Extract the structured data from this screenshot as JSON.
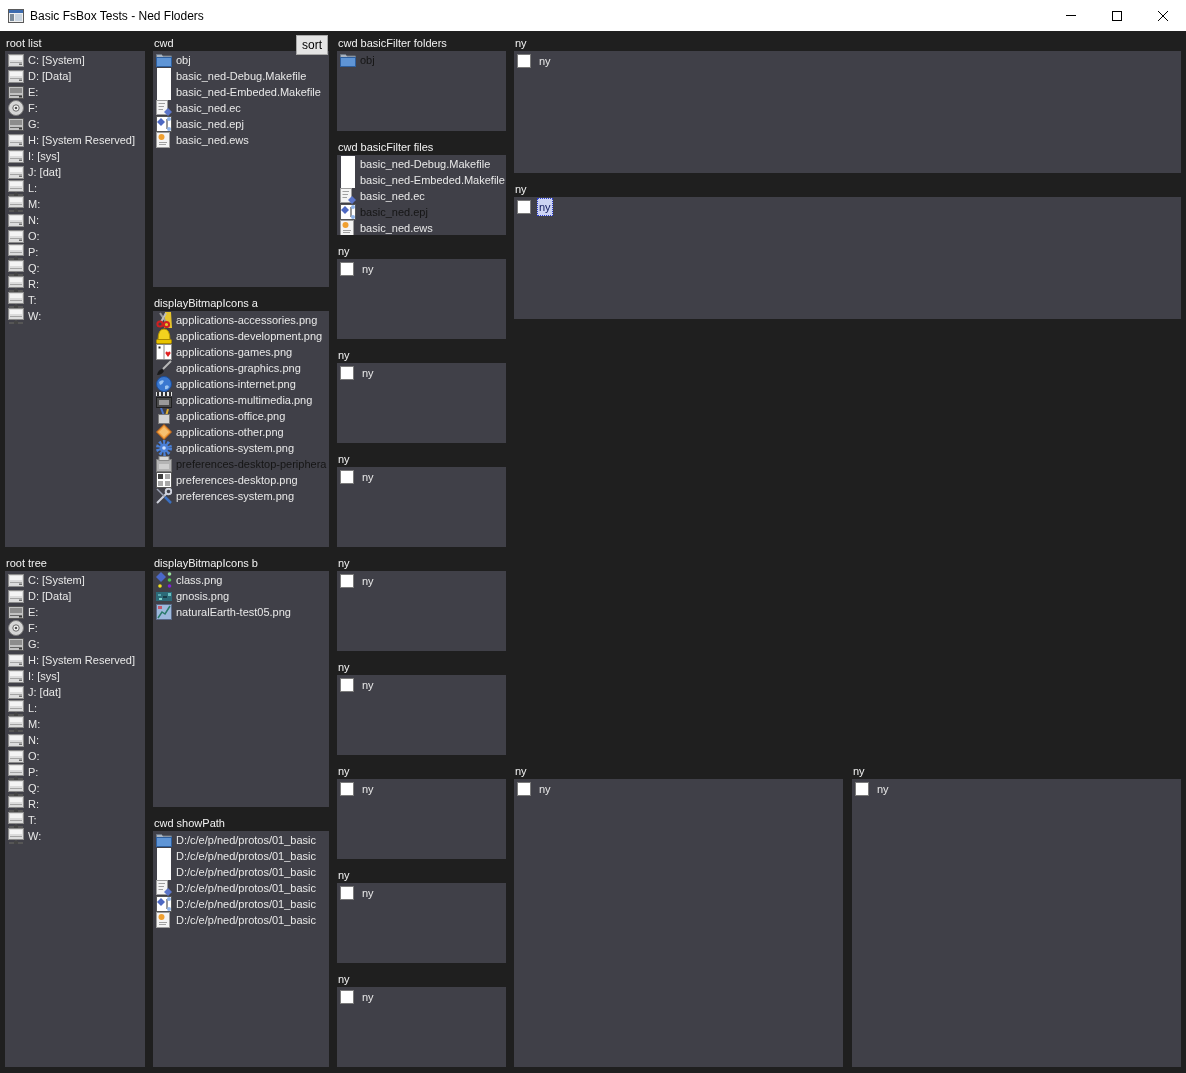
{
  "window": {
    "title": "Basic FsBox Tests - Ned Floders"
  },
  "columns": [
    {
      "sections": [
        {
          "kind": "list",
          "label": "root list",
          "items": [
            {
              "text": "C: [System]",
              "kind": "hdd",
              "selected": false
            },
            {
              "text": "D: [Data]",
              "kind": "hdd",
              "selected": false
            },
            {
              "text": "E:",
              "kind": "disk",
              "selected": false
            },
            {
              "text": "F:",
              "kind": "cd",
              "selected": false
            },
            {
              "text": "G:",
              "kind": "disk",
              "selected": false
            },
            {
              "text": "H: [System Reserved]",
              "kind": "hdd",
              "selected": false
            },
            {
              "text": "I: [sys]",
              "kind": "hdd",
              "selected": false
            },
            {
              "text": "J: [dat]",
              "kind": "hdd",
              "selected": false
            },
            {
              "text": "L:",
              "kind": "net",
              "selected": false
            },
            {
              "text": "M:",
              "kind": "net",
              "selected": false
            },
            {
              "text": "N:",
              "kind": "hdd",
              "selected": false
            },
            {
              "text": "O:",
              "kind": "hdd",
              "selected": false
            },
            {
              "text": "P:",
              "kind": "net",
              "selected": false
            },
            {
              "text": "Q:",
              "kind": "net",
              "selected": false
            },
            {
              "text": "R:",
              "kind": "net",
              "selected": false
            },
            {
              "text": "T:",
              "kind": "net",
              "selected": false
            },
            {
              "text": "W:",
              "kind": "net",
              "selected": false
            }
          ]
        },
        {
          "kind": "list",
          "label": "root tree",
          "items": [
            {
              "text": "C: [System]",
              "kind": "hdd",
              "selected": false
            },
            {
              "text": "D: [Data]",
              "kind": "hdd",
              "selected": false
            },
            {
              "text": "E:",
              "kind": "disk",
              "selected": false
            },
            {
              "text": "F:",
              "kind": "cd",
              "selected": false
            },
            {
              "text": "G:",
              "kind": "disk",
              "selected": false
            },
            {
              "text": "H: [System Reserved]",
              "kind": "hdd",
              "selected": false
            },
            {
              "text": "I: [sys]",
              "kind": "hdd",
              "selected": false
            },
            {
              "text": "J: [dat]",
              "kind": "hdd",
              "selected": false
            },
            {
              "text": "L:",
              "kind": "net",
              "selected": false
            },
            {
              "text": "M:",
              "kind": "net",
              "selected": false
            },
            {
              "text": "N:",
              "kind": "hdd",
              "selected": false
            },
            {
              "text": "O:",
              "kind": "hdd",
              "selected": false
            },
            {
              "text": "P:",
              "kind": "net",
              "selected": false
            },
            {
              "text": "Q:",
              "kind": "net",
              "selected": false
            },
            {
              "text": "R:",
              "kind": "net",
              "selected": false
            },
            {
              "text": "T:",
              "kind": "net",
              "selected": false
            },
            {
              "text": "W:",
              "kind": "net",
              "selected": false
            }
          ]
        }
      ]
    },
    {
      "sections": [
        {
          "kind": "list",
          "label": "cwd",
          "button": "sort",
          "items": [
            {
              "text": "obj",
              "kind": "folder",
              "selected": false
            },
            {
              "text": "basic_ned-Debug.Makefile",
              "kind": "blank",
              "selected": false
            },
            {
              "text": "basic_ned-Embeded.Makefile",
              "kind": "blank",
              "selected": false
            },
            {
              "text": "basic_ned.ec",
              "kind": "source",
              "selected": false
            },
            {
              "text": "basic_ned.epj",
              "kind": "project",
              "selected": false
            },
            {
              "text": "basic_ned.ews",
              "kind": "workspace",
              "selected": false
            }
          ]
        },
        {
          "kind": "list",
          "label": "displayBitmapIcons a",
          "items": [
            {
              "text": "applications-accessories.png",
              "kind": "scissors",
              "selected": false
            },
            {
              "text": "applications-development.png",
              "kind": "hardhat",
              "selected": false
            },
            {
              "text": "applications-games.png",
              "kind": "cards",
              "selected": false
            },
            {
              "text": "applications-graphics.png",
              "kind": "brush",
              "selected": false
            },
            {
              "text": "applications-internet.png",
              "kind": "globe",
              "selected": false
            },
            {
              "text": "applications-multimedia.png",
              "kind": "clapper",
              "selected": false
            },
            {
              "text": "applications-office.png",
              "kind": "cup",
              "selected": false
            },
            {
              "text": "applications-other.png",
              "kind": "diamond",
              "selected": false
            },
            {
              "text": "applications-system.png",
              "kind": "gear",
              "selected": false
            },
            {
              "text": "preferences-desktop-periphera",
              "kind": "device",
              "selected": true
            },
            {
              "text": "preferences-desktop.png",
              "kind": "desktop",
              "selected": false
            },
            {
              "text": "preferences-system.png",
              "kind": "tools",
              "selected": false
            }
          ]
        },
        {
          "kind": "list",
          "label": "displayBitmapIcons b",
          "items": [
            {
              "text": "class.png",
              "kind": "class",
              "selected": false
            },
            {
              "text": "gnosis.png",
              "kind": "thumbnail",
              "selected": false
            },
            {
              "text": "naturalEarth-test05.png",
              "kind": "map",
              "selected": false
            }
          ]
        },
        {
          "kind": "list",
          "label": "cwd showPath",
          "items": [
            {
              "text": "D:/c/e/p/ned/protos/01_basic",
              "kind": "folder",
              "selected": false
            },
            {
              "text": "D:/c/e/p/ned/protos/01_basic",
              "kind": "blank",
              "selected": false
            },
            {
              "text": "D:/c/e/p/ned/protos/01_basic",
              "kind": "blank",
              "selected": false
            },
            {
              "text": "D:/c/e/p/ned/protos/01_basic",
              "kind": "source",
              "selected": false
            },
            {
              "text": "D:/c/e/p/ned/protos/01_basic",
              "kind": "project",
              "selected": false
            },
            {
              "text": "D:/c/e/p/ned/protos/01_basic",
              "kind": "workspace",
              "selected": false
            }
          ]
        }
      ]
    },
    {
      "sections": [
        {
          "kind": "list",
          "label": "cwd basicFilter folders",
          "items": [
            {
              "text": "obj",
              "kind": "folder",
              "selected": true
            }
          ]
        },
        {
          "kind": "list",
          "label": "cwd basicFilter files",
          "items": [
            {
              "text": "basic_ned-Debug.Makefile",
              "kind": "blank",
              "selected": false
            },
            {
              "text": "basic_ned-Embeded.Makefile",
              "kind": "blank",
              "selected": false
            },
            {
              "text": "basic_ned.ec",
              "kind": "source",
              "selected": false
            },
            {
              "text": "basic_ned.epj",
              "kind": "project",
              "selected": true
            },
            {
              "text": "basic_ned.ews",
              "kind": "workspace",
              "selected": false
            }
          ]
        },
        {
          "kind": "checks",
          "label": "ny",
          "items": [
            {
              "text": "ny",
              "checked": false,
              "focused": false
            }
          ]
        },
        {
          "kind": "checks",
          "label": "ny",
          "items": [
            {
              "text": "ny",
              "checked": false,
              "focused": false
            }
          ]
        },
        {
          "kind": "checks",
          "label": "ny",
          "items": [
            {
              "text": "ny",
              "checked": false,
              "focused": false
            }
          ]
        },
        {
          "kind": "checks",
          "label": "ny",
          "items": [
            {
              "text": "ny",
              "checked": false,
              "focused": false
            }
          ]
        },
        {
          "kind": "checks",
          "label": "ny",
          "items": [
            {
              "text": "ny",
              "checked": false,
              "focused": false
            }
          ]
        },
        {
          "kind": "checks",
          "label": "ny",
          "items": [
            {
              "text": "ny",
              "checked": false,
              "focused": false
            }
          ]
        },
        {
          "kind": "checks",
          "label": "ny",
          "items": [
            {
              "text": "ny",
              "checked": false,
              "focused": false
            }
          ]
        },
        {
          "kind": "checks",
          "label": "ny",
          "items": [
            {
              "text": "ny",
              "checked": false,
              "focused": false
            }
          ]
        }
      ]
    }
  ],
  "wide_column": {
    "top_sections": [
      {
        "kind": "checks",
        "label": "ny",
        "items": [
          {
            "text": "ny",
            "checked": false,
            "focused": false
          }
        ]
      },
      {
        "kind": "checks",
        "label": "ny",
        "items": [
          {
            "text": "ny",
            "checked": false,
            "focused": true
          }
        ]
      }
    ],
    "bottom_sections": [
      {
        "kind": "checks",
        "label": "ny",
        "items": [
          {
            "text": "ny",
            "checked": false,
            "focused": false
          }
        ]
      },
      {
        "kind": "checks",
        "label": "ny",
        "items": [
          {
            "text": "ny",
            "checked": false,
            "focused": false
          }
        ]
      }
    ]
  }
}
